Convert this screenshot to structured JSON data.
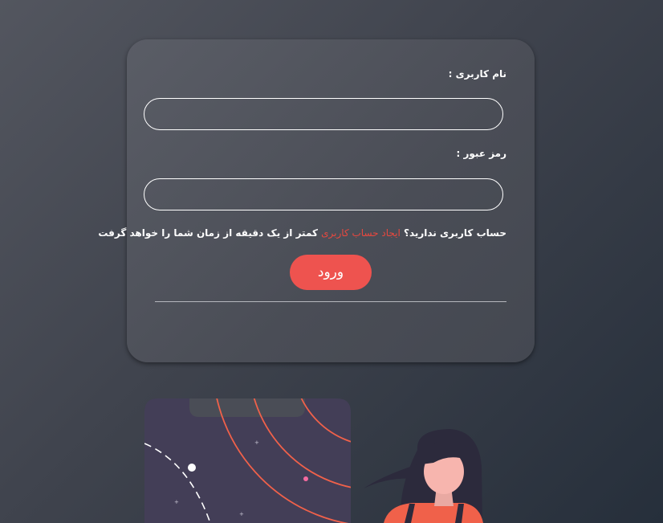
{
  "login": {
    "username_label": "نام کاربری :",
    "username_value": "",
    "password_label": "رمز عبور :",
    "password_value": "",
    "signup_prefix": "حساب کاربری ندارید؟",
    "signup_link": "ایجاد حساب کاربری",
    "signup_suffix": "کمتر از یک دقیقه از زمان شما را خواهد گرفت",
    "submit_label": "ورود"
  },
  "colors": {
    "accent": "#ee534f",
    "link": "#e8483f",
    "card": "#4f525b",
    "phone": "#433e57"
  },
  "illustration": {
    "phone_icon": "phone-illustration",
    "person_icon": "woman-illustration"
  }
}
